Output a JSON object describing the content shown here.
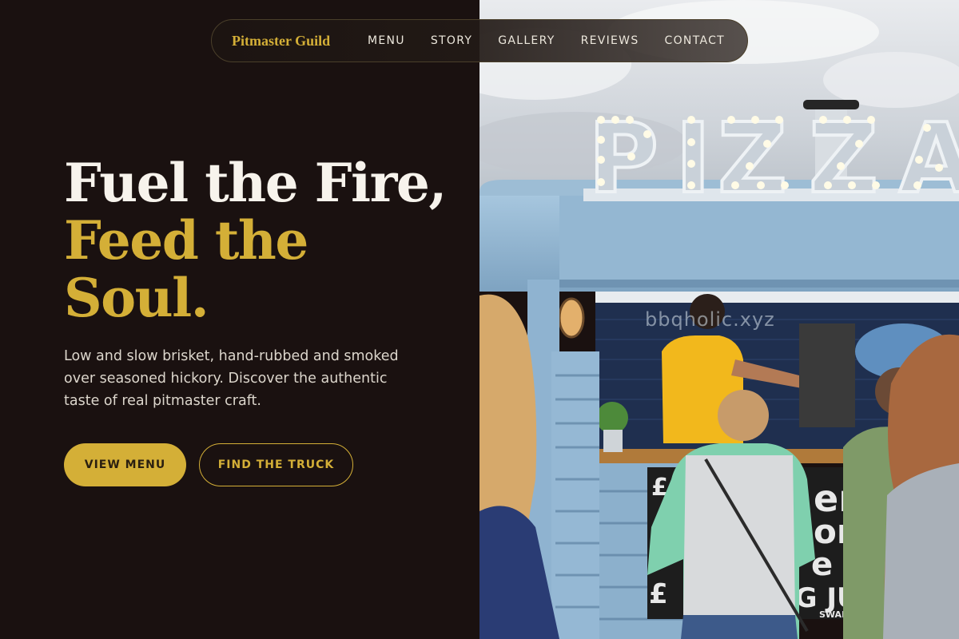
{
  "brand": {
    "name": "Pitmaster Guild",
    "color": "#d4af37"
  },
  "nav": {
    "links": [
      {
        "label": "MENU"
      },
      {
        "label": "STORY"
      },
      {
        "label": "GALLERY"
      },
      {
        "label": "REVIEWS"
      },
      {
        "label": "CONTACT"
      }
    ]
  },
  "hero": {
    "title_line1": "Fuel the Fire,",
    "title_line2": "Feed the",
    "title_line3": "Soul.",
    "description": "Low and slow brisket, hand-rubbed and smoked over seasoned hickory. Discover the authentic taste of real pitmaster craft.",
    "primary_button": "VIEW MENU",
    "secondary_button": "FIND THE TRUCK"
  },
  "image": {
    "sign_text": "PIZZA",
    "watermark": "bbqholic.xyz",
    "chalkboard_lines": [
      "£",
      "erit",
      "oni",
      "e -",
      "£",
      "IG JU",
      "SWAP FOR VE"
    ]
  },
  "colors": {
    "background": "#1a1110",
    "accent": "#d4af37",
    "text_light": "#f7f3ec",
    "truck_blue": "#8fb3d0"
  }
}
